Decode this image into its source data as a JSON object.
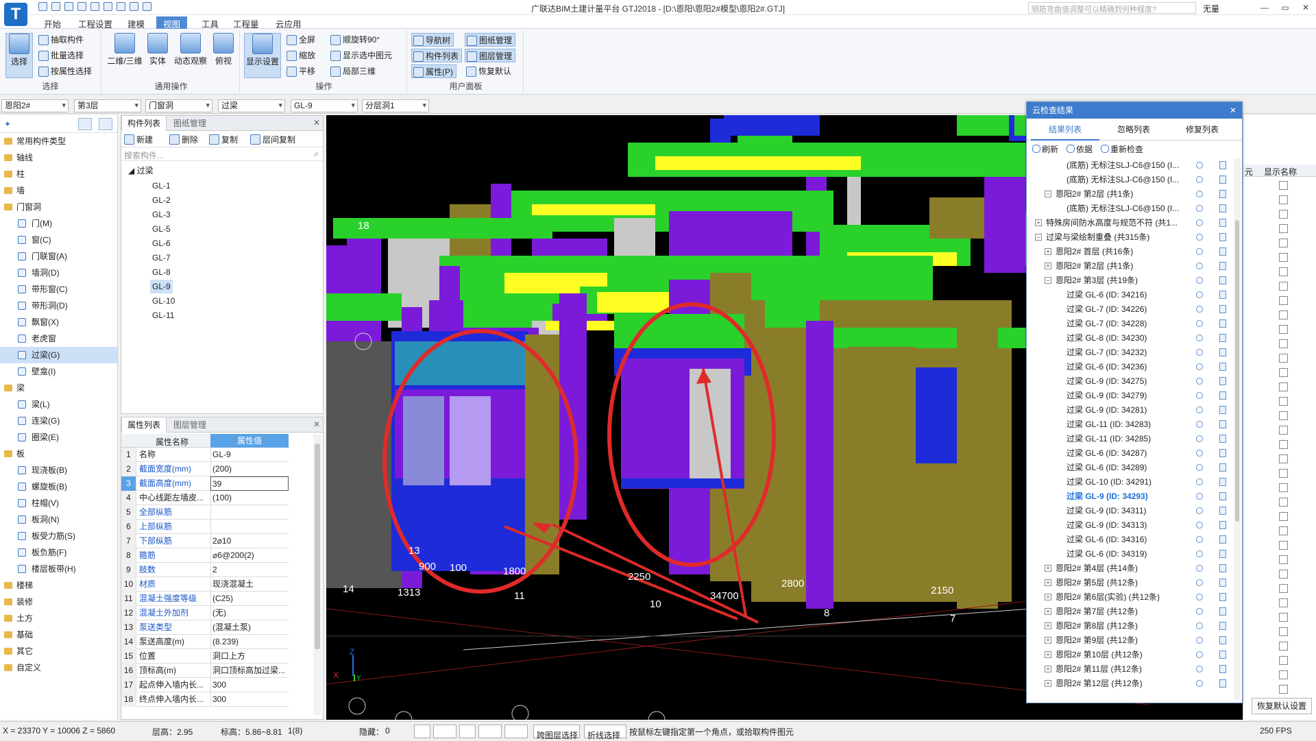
{
  "window": {
    "title": "广联达BIM土建计量平台 GTJ2018 - [D:\\恩阳\\恩阳2#模型\\恩阳2#.GTJ]",
    "logo_letter": "T",
    "help_search_placeholder": "钢筋弯曲值调整可以精确到何种程度?",
    "user": "无量",
    "controls": [
      "—",
      "▭",
      "✕"
    ]
  },
  "menu": [
    "开始",
    "工程设置",
    "建模",
    "视图",
    "工具",
    "工程量",
    "云应用"
  ],
  "ribbon": {
    "select": {
      "label": "选择",
      "big": "选择",
      "small": [
        "抽取构件",
        "批量选择",
        "按属性选择"
      ]
    },
    "general": {
      "label": "通用操作",
      "big": [
        "二维/三维",
        "实体",
        "动态观察",
        "俯视"
      ]
    },
    "ops": {
      "label": "操作",
      "big": "显示设置",
      "small": [
        "全屏",
        "缩放",
        "平移",
        "顺旋转90°",
        "显示选中图元",
        "局部三维"
      ]
    },
    "user": {
      "label": "用户面板",
      "small": [
        "导航树",
        "图纸管理",
        "构件列表",
        "图层管理",
        "属性(P)",
        "恢复默认"
      ]
    }
  },
  "filters": [
    "恩阳2#",
    "第3层",
    "门窗洞",
    "过梁",
    "GL-9",
    "分层洞1"
  ],
  "navtree": [
    {
      "label": "常用构件类型",
      "folder": true
    },
    {
      "label": "轴线",
      "folder": true
    },
    {
      "label": "柱",
      "folder": true
    },
    {
      "label": "墙",
      "folder": true
    },
    {
      "label": "门窗洞",
      "folder": true,
      "open": true
    },
    {
      "label": "门(M)"
    },
    {
      "label": "窗(C)"
    },
    {
      "label": "门联窗(A)"
    },
    {
      "label": "墙洞(D)"
    },
    {
      "label": "带形窗(C)"
    },
    {
      "label": "带形洞(D)"
    },
    {
      "label": "飘窗(X)"
    },
    {
      "label": "老虎窗"
    },
    {
      "label": "过梁(G)",
      "selected": true
    },
    {
      "label": "壁龛(I)"
    },
    {
      "label": "梁",
      "folder": true,
      "open": true
    },
    {
      "label": "梁(L)"
    },
    {
      "label": "连梁(G)"
    },
    {
      "label": "圈梁(E)"
    },
    {
      "label": "板",
      "folder": true,
      "open": true
    },
    {
      "label": "现浇板(B)"
    },
    {
      "label": "螺旋板(B)"
    },
    {
      "label": "柱帽(V)"
    },
    {
      "label": "板洞(N)"
    },
    {
      "label": "板受力筋(S)"
    },
    {
      "label": "板负筋(F)"
    },
    {
      "label": "楼层板带(H)"
    },
    {
      "label": "楼梯",
      "folder": true
    },
    {
      "label": "装修",
      "folder": true
    },
    {
      "label": "土方",
      "folder": true
    },
    {
      "label": "基础",
      "folder": true
    },
    {
      "label": "其它",
      "folder": true
    },
    {
      "label": "自定义",
      "folder": true
    }
  ],
  "complist": {
    "tabs": [
      "构件列表",
      "图纸管理"
    ],
    "tools": [
      "新建",
      "删除",
      "复制",
      "层间复制"
    ],
    "search_placeholder": "搜索构件...",
    "root": "过梁",
    "items": [
      "GL-1",
      "GL-2",
      "GL-3",
      "GL-5",
      "GL-6",
      "GL-7",
      "GL-8",
      "GL-9",
      "GL-10",
      "GL-11"
    ],
    "selected": "GL-9"
  },
  "props": {
    "tabs": [
      "属性列表",
      "图层管理"
    ],
    "header": [
      "属性名称",
      "属性值"
    ],
    "rows": [
      [
        "1",
        "名称",
        "GL-9"
      ],
      [
        "2",
        "截面宽度(mm)",
        "(200)"
      ],
      [
        "3",
        "截面高度(mm)",
        "39"
      ],
      [
        "4",
        "中心线距左墙皮...",
        "(100)"
      ],
      [
        "5",
        "全部纵筋",
        ""
      ],
      [
        "6",
        "上部纵筋",
        ""
      ],
      [
        "7",
        "下部纵筋",
        "2⌀10"
      ],
      [
        "8",
        "箍筋",
        "⌀6@200(2)"
      ],
      [
        "9",
        "肢数",
        "2"
      ],
      [
        "10",
        "材质",
        "现浇混凝土"
      ],
      [
        "11",
        "混凝土强度等级",
        "(C25)"
      ],
      [
        "12",
        "混凝土外加剂",
        "(无)"
      ],
      [
        "13",
        "泵送类型",
        "(混凝土泵)"
      ],
      [
        "14",
        "泵送高度(m)",
        "(8.239)"
      ],
      [
        "15",
        "位置",
        "洞口上方"
      ],
      [
        "16",
        "顶标高(m)",
        "洞口顶标高加过梁..."
      ],
      [
        "17",
        "起点伸入墙内长...",
        "300"
      ],
      [
        "18",
        "终点伸入墙内长...",
        "300"
      ]
    ]
  },
  "viewport": {
    "grid_labels": [
      "18",
      "13",
      "900",
      "100",
      "1800",
      "2250",
      "2800",
      "34700",
      "2150",
      "14",
      "1313",
      "11",
      "10",
      "8",
      "7"
    ],
    "axis": {
      "x": "X",
      "y": "Y",
      "z": "Z"
    }
  },
  "cloud": {
    "title": "云检查结果",
    "tabs": [
      "结果列表",
      "忽略列表",
      "修复列表"
    ],
    "tools": [
      "刷新",
      "依据",
      "重新检查"
    ],
    "rows": [
      {
        "t": "(底筋) 无标注SLJ-C6@150 (I...",
        "lv": 3
      },
      {
        "t": "(底筋) 无标注SLJ-C6@150 (I...",
        "lv": 3
      },
      {
        "t": "恩阳2# 第2层 (共1条)",
        "lv": 2,
        "exp": "−"
      },
      {
        "t": "(底筋) 无标注SLJ-C6@150 (I...",
        "lv": 3
      },
      {
        "t": "特殊房间防水高度与规范不符 (共1...",
        "lv": 1,
        "exp": "+"
      },
      {
        "t": "过梁与梁绘制重叠 (共315条)",
        "lv": 1,
        "exp": "−"
      },
      {
        "t": "恩阳2# 首层 (共16条)",
        "lv": 2,
        "exp": "+"
      },
      {
        "t": "恩阳2# 第2层 (共1条)",
        "lv": 2,
        "exp": "+"
      },
      {
        "t": "恩阳2# 第3层 (共19条)",
        "lv": 2,
        "exp": "−"
      },
      {
        "t": "过梁 GL-6 (ID: 34216)",
        "lv": 3
      },
      {
        "t": "过梁 GL-7 (ID: 34226)",
        "lv": 3
      },
      {
        "t": "过梁 GL-7 (ID: 34228)",
        "lv": 3
      },
      {
        "t": "过梁 GL-8 (ID: 34230)",
        "lv": 3
      },
      {
        "t": "过梁 GL-7 (ID: 34232)",
        "lv": 3
      },
      {
        "t": "过梁 GL-6 (ID: 34236)",
        "lv": 3
      },
      {
        "t": "过梁 GL-9 (ID: 34275)",
        "lv": 3
      },
      {
        "t": "过梁 GL-9 (ID: 34279)",
        "lv": 3
      },
      {
        "t": "过梁 GL-9 (ID: 34281)",
        "lv": 3
      },
      {
        "t": "过梁 GL-11 (ID: 34283)",
        "lv": 3
      },
      {
        "t": "过梁 GL-11 (ID: 34285)",
        "lv": 3
      },
      {
        "t": "过梁 GL-6 (ID: 34287)",
        "lv": 3
      },
      {
        "t": "过梁 GL-6 (ID: 34289)",
        "lv": 3
      },
      {
        "t": "过梁 GL-10 (ID: 34291)",
        "lv": 3
      },
      {
        "t": "过梁 GL-9 (ID: 34293)",
        "lv": 3,
        "sel": true
      },
      {
        "t": "过梁 GL-9 (ID: 34311)",
        "lv": 3
      },
      {
        "t": "过梁 GL-9 (ID: 34313)",
        "lv": 3
      },
      {
        "t": "过梁 GL-6 (ID: 34316)",
        "lv": 3
      },
      {
        "t": "过梁 GL-6 (ID: 34319)",
        "lv": 3
      },
      {
        "t": "恩阳2# 第4层 (共14条)",
        "lv": 2,
        "exp": "+"
      },
      {
        "t": "恩阳2# 第5层 (共12条)",
        "lv": 2,
        "exp": "+"
      },
      {
        "t": "恩阳2# 第6层(实验) (共12条)",
        "lv": 2,
        "exp": "+"
      },
      {
        "t": "恩阳2# 第7层 (共12条)",
        "lv": 2,
        "exp": "+"
      },
      {
        "t": "恩阳2# 第8层 (共12条)",
        "lv": 2,
        "exp": "+"
      },
      {
        "t": "恩阳2# 第9层 (共12条)",
        "lv": 2,
        "exp": "+"
      },
      {
        "t": "恩阳2# 第10层 (共12条)",
        "lv": 2,
        "exp": "+"
      },
      {
        "t": "恩阳2# 第11层 (共12条)",
        "lv": 2,
        "exp": "+"
      },
      {
        "t": "恩阳2# 第12层 (共12条)",
        "lv": 2,
        "exp": "+"
      }
    ]
  },
  "rightgrid": {
    "headers": [
      "元",
      "显示名称"
    ],
    "restore_button": "恢复默认设置"
  },
  "status": {
    "coords": "X = 23370 Y = 10006 Z = 5860",
    "floor_height": "层高：2.95",
    "elev": "标高：5.86~8.81",
    "count": "1(8)",
    "hidden": "隐藏：",
    "hidden_count": "0",
    "cross_floor": "跨图层选择",
    "polyline": "折线选择",
    "hint": "按鼠标左键指定第一个角点，或拾取构件图元",
    "fps": "250 FPS"
  }
}
